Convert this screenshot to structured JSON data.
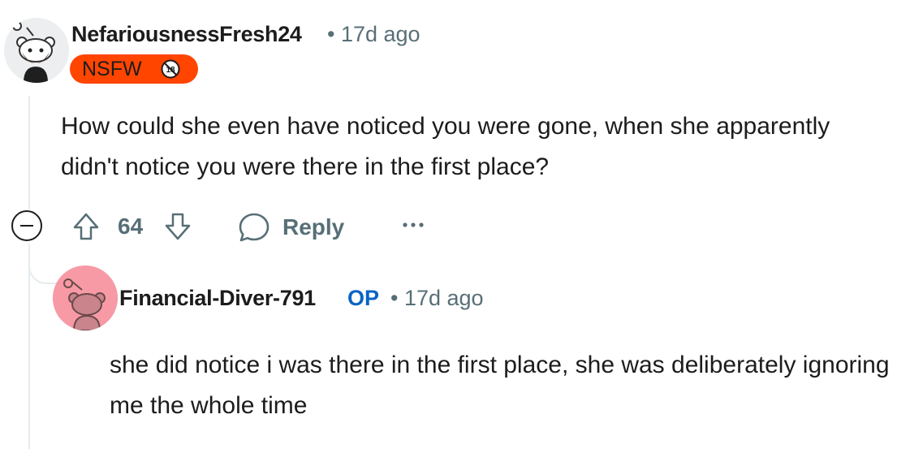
{
  "comments": [
    {
      "username": "NefariousnessFresh24",
      "separator": "•",
      "time": "17d ago",
      "flair": "NSFW",
      "body": "How could she even have noticed you were gone, when she apparently didn't notice you were there in the first place?",
      "votes": "64",
      "reply_label": "Reply"
    },
    {
      "username": "Financial-Diver-791",
      "op_badge": "OP",
      "separator": "•",
      "time": "17d ago",
      "body": "she did notice i was there in the first place, she was deliberately ignoring me the whole time"
    }
  ],
  "colors": {
    "nsfw": "#ff4500",
    "op": "#0a63c5",
    "meta": "#576f76",
    "avatar2_bg": "#f79aa6"
  }
}
